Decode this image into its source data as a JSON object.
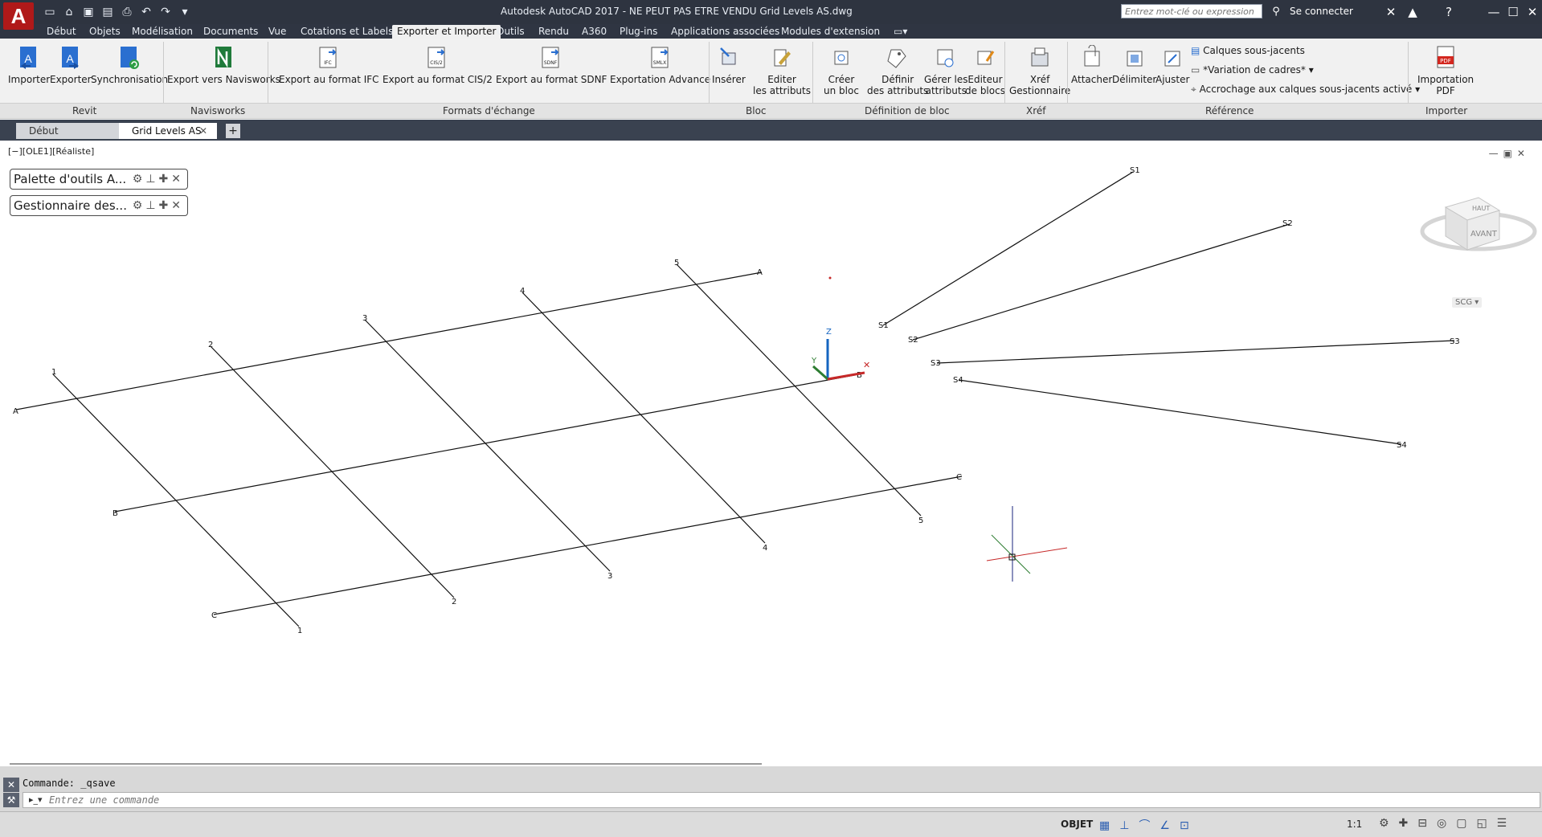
{
  "app": {
    "logo_letter": "A",
    "title": "Autodesk AutoCAD 2017 - NE PEUT PAS ETRE VENDU    Grid Levels AS.dwg",
    "search_placeholder": "Entrez mot-clé ou expression",
    "signin_label": "Se connecter",
    "help_label": "?"
  },
  "menu_tabs": [
    {
      "label": "Début"
    },
    {
      "label": "Objets"
    },
    {
      "label": "Modélisation"
    },
    {
      "label": "Documents"
    },
    {
      "label": "Vue"
    },
    {
      "label": "Cotations et Labels"
    },
    {
      "label": "Exporter et Importer"
    },
    {
      "label": "Outils"
    },
    {
      "label": "Rendu"
    },
    {
      "label": "A360"
    },
    {
      "label": "Plug-ins"
    },
    {
      "label": "Applications associées"
    },
    {
      "label": "Modules d'extension"
    }
  ],
  "ribbon": {
    "revit": {
      "importer": "Importer",
      "exporter": "Exporter",
      "synchronisation": "Synchronisation"
    },
    "navisworks": {
      "export": "Export vers Navisworks"
    },
    "formats": {
      "ifc": "Export au format IFC",
      "cis2": "Export au format CIS/2",
      "sdnf": "Export au format SDNF",
      "advance": "Exportation Advance"
    },
    "bloc": {
      "inserer": "Insérer",
      "editer_1": "Editer",
      "editer_2": "les attributs"
    },
    "definition": {
      "creer_1": "Créer",
      "creer_2": "un bloc",
      "definir_1": "Définir",
      "definir_2": "des attributs",
      "gerer_1": "Gérer les",
      "gerer_2": "attributs",
      "editeur_1": "Editeur",
      "editeur_2": "de blocs"
    },
    "xref": {
      "xref_1": "Xréf",
      "xref_2": "Gestionnaire"
    },
    "reference": {
      "attacher": "Attacher",
      "delimiter": "Délimiter",
      "ajuster": "Ajuster",
      "calques": "Calques sous-jacents",
      "variation": "*Variation de cadres*",
      "accrochage": "Accrochage aux calques sous-jacents activé"
    },
    "importer": {
      "pdf_1": "Importation",
      "pdf_2": "PDF"
    },
    "panels": {
      "revit": "Revit",
      "navisworks": "Navisworks",
      "formats": "Formats d'échange",
      "bloc": "Bloc",
      "definition": "Définition de bloc",
      "xref": "Xréf",
      "reference": "Référence",
      "importer": "Importer"
    }
  },
  "doc_tabs": {
    "start": "Début",
    "current": "Grid Levels AS",
    "add": "+"
  },
  "viewport": {
    "label": "[−][OLE1][Réaliste]",
    "palettes": [
      "Palette d'outils A...",
      "Gestionnaire des..."
    ],
    "viewcube_top": "HAUT",
    "viewcube_front": "AVANT",
    "ucs_label": "SCG",
    "grid_labels": {
      "numbers": [
        "1",
        "2",
        "3",
        "4",
        "5"
      ],
      "letters": [
        "A",
        "B",
        "C"
      ],
      "radial_ends": [
        "S1",
        "S2",
        "S3",
        "S4"
      ]
    },
    "colors": {
      "x_axis": "#c62828",
      "y_axis": "#2e7d32",
      "z_axis": "#1565c0",
      "grid_line": "#111111"
    }
  },
  "command": {
    "history": "Commande: _qsave",
    "placeholder": "Entrez une commande"
  },
  "status": {
    "model": "OBJET",
    "scale": "1:1"
  }
}
